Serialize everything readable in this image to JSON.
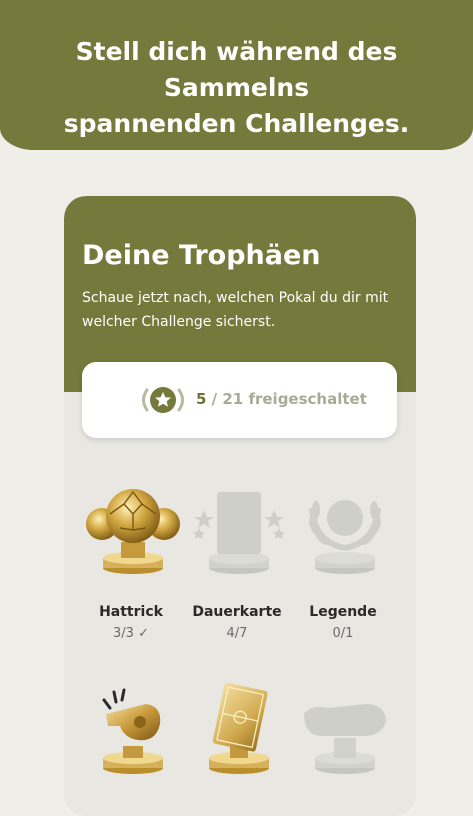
{
  "banner": {
    "line1": "Stell dich während des Sammelns",
    "line2": "spannenden Challenges."
  },
  "screen": {
    "title": "Deine Trophäen",
    "subtitle": "Schaue jetzt nach, welchen Pokal du dir mit welcher Challenge sicherst.",
    "counter": {
      "unlocked": "5",
      "rest": " / 21 freigeschaltet"
    }
  },
  "trophies": [
    {
      "name": "Hattrick",
      "progress": "3/3 ✓",
      "state": "unlocked",
      "icon": "golden-ball-icon"
    },
    {
      "name": "Dauerkarte",
      "progress": "4/7",
      "state": "locked",
      "icon": "ticket-stars-icon"
    },
    {
      "name": "Legende",
      "progress": "0/1",
      "state": "locked",
      "icon": "laurel-wreath-icon"
    },
    {
      "state": "unlocked",
      "icon": "whistle-icon"
    },
    {
      "state": "unlocked",
      "icon": "tactic-board-icon"
    },
    {
      "state": "locked",
      "icon": "shoe-icon"
    }
  ],
  "colors": {
    "brand": "#76793c",
    "gold": "#c9a650",
    "locked": "#cfcfca"
  }
}
